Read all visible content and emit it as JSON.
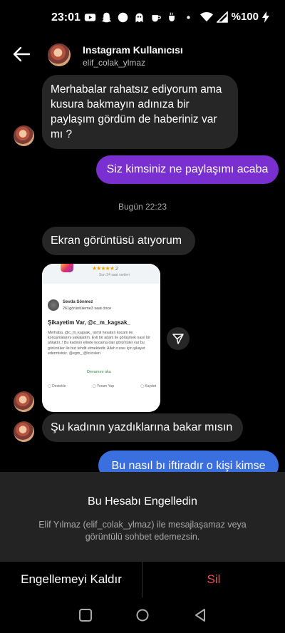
{
  "status_bar": {
    "time": "23:01",
    "battery": "%100",
    "icons": [
      "youtube-icon",
      "snapchat-icon",
      "circle-icon",
      "ghost-icon",
      "tea-icon",
      "cup-icon",
      "dot-icon"
    ]
  },
  "header": {
    "name": "Instagram Kullanıcısı",
    "username": "elif_colak_ylmaz"
  },
  "messages": [
    {
      "direction": "in",
      "text": "Merhabalar  rahatsız ediyorum ama kusura bakmayın adınıza bir paylaşım gördüm de haberiniz var mı ?"
    },
    {
      "direction": "out",
      "text": "Siz kimsiniz ne paylaşımı acaba"
    },
    {
      "direction": "in",
      "text": "Ekran görüntüsü atıyorum"
    },
    {
      "direction": "in",
      "text": "Şu kadının yazdıklarına bakar mısın"
    },
    {
      "direction": "out",
      "text": "Bu nasıl bı iftiradır o kişi kimse"
    }
  ],
  "day_stamp": "Bugün 22:23",
  "shared_screenshot": {
    "rating": "★★★★★",
    "rating_value": "2",
    "rating_sub": "Son 24 saat verileri",
    "author": "Sevda Sönmez",
    "author_meta": "261görüntüleme3 saat önce",
    "title": "Şikayetim Var, @c_m_kagsak_",
    "body": "Merhaba. @c_m_kagsak_ isimli hesabın kocam ile konuşmalarını yakaladım. Evli bir adam ile görüşmek nasıl bir ahlaktır..! Bu kadının elinde kocama dair görüntüler var bu görüntüler ile bizi tehdit etmektedir. Allah rızası için şikayet edermisiniz. @egm_ @tcicisleri",
    "more": "Devamını oku",
    "actions": [
      "Destekle",
      "Yorum Yap",
      "Kaydet"
    ]
  },
  "block_panel": {
    "title": "Bu Hesabı Engelledin",
    "description": "Elif Yılmaz (elif_colak_ylmaz) ile mesajlaşamaz veya görüntülü sohbet edemezsin."
  },
  "actions": {
    "unblock": "Engellemeyi Kaldır",
    "delete": "Sil"
  },
  "colors": {
    "incoming_bubble": "#262626",
    "outgoing_purple": "#7a2fd0",
    "outgoing_blue": "#3a6fe0",
    "delete": "#ed4956"
  }
}
